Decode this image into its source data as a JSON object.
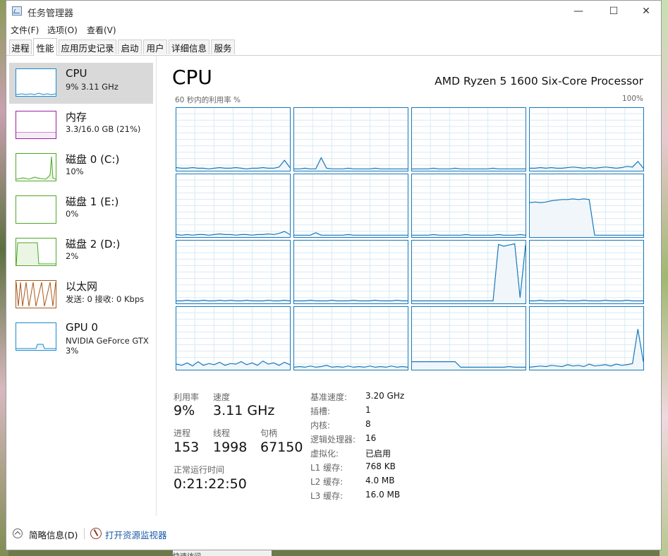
{
  "window": {
    "title": "任务管理器",
    "minimize": "—",
    "maximize": "☐",
    "close": "✕"
  },
  "menu": [
    "文件(F)",
    "选项(O)",
    "查看(V)"
  ],
  "tabs": [
    "进程",
    "性能",
    "应用历史记录",
    "启动",
    "用户",
    "详细信息",
    "服务"
  ],
  "active_tab": "性能",
  "sidebar": [
    {
      "title": "CPU",
      "sub": "9% 3.11 GHz",
      "sub2": "",
      "color": "#1a8ad0"
    },
    {
      "title": "内存",
      "sub": "3.3/16.0 GB (21%)",
      "sub2": "",
      "color": "#9b1fa0"
    },
    {
      "title": "磁盘 0 (C:)",
      "sub": "10%",
      "sub2": "",
      "color": "#4ca825"
    },
    {
      "title": "磁盘 1 (E:)",
      "sub": "0%",
      "sub2": "",
      "color": "#4ca825"
    },
    {
      "title": "磁盘 2 (D:)",
      "sub": "2%",
      "sub2": "",
      "color": "#4ca825"
    },
    {
      "title": "以太网",
      "sub": "发送: 0 接收: 0 Kbps",
      "sub2": "",
      "color": "#a8581c"
    },
    {
      "title": "GPU 0",
      "sub": "NVIDIA GeForce GTX",
      "sub2": "3%",
      "color": "#1a8ad0"
    }
  ],
  "main": {
    "title": "CPU",
    "processor": "AMD Ryzen 5 1600 Six-Core Processor",
    "axis_label": "60 秒内的利用率 %",
    "axis_max": "100%"
  },
  "core_graphs": [
    [
      4,
      3,
      3,
      4,
      3,
      3,
      2,
      3,
      4,
      3,
      3,
      4,
      3,
      2,
      3,
      3,
      4,
      3,
      3,
      5,
      16,
      4
    ],
    [
      2,
      2,
      3,
      2,
      2,
      20,
      3,
      2,
      2,
      2,
      3,
      2,
      2,
      2,
      2,
      3,
      2,
      2,
      2,
      2,
      2,
      2
    ],
    [
      2,
      2,
      2,
      2,
      3,
      2,
      2,
      2,
      3,
      2,
      2,
      2,
      2,
      2,
      2,
      3,
      2,
      2,
      2,
      2,
      2,
      2
    ],
    [
      3,
      3,
      4,
      3,
      4,
      3,
      3,
      4,
      5,
      4,
      3,
      4,
      3,
      4,
      5,
      4,
      3,
      4,
      6,
      5,
      14,
      3
    ],
    [
      3,
      2,
      3,
      2,
      3,
      3,
      2,
      3,
      4,
      3,
      3,
      2,
      3,
      3,
      2,
      3,
      3,
      4,
      3,
      5,
      8,
      3
    ],
    [
      2,
      2,
      2,
      2,
      6,
      2,
      2,
      2,
      2,
      2,
      3,
      2,
      2,
      2,
      2,
      2,
      2,
      2,
      2,
      2,
      2,
      2
    ],
    [
      2,
      2,
      2,
      2,
      3,
      2,
      2,
      2,
      2,
      2,
      3,
      2,
      2,
      2,
      2,
      2,
      3,
      2,
      2,
      2,
      3,
      2
    ],
    [
      55,
      56,
      55,
      56,
      58,
      59,
      60,
      60,
      61,
      60,
      61,
      60,
      2,
      2,
      2,
      2,
      2,
      2,
      2,
      2,
      2,
      2
    ],
    [
      3,
      3,
      4,
      3,
      3,
      4,
      3,
      3,
      4,
      3,
      4,
      3,
      3,
      4,
      3,
      3,
      3,
      4,
      3,
      3,
      4,
      3
    ],
    [
      3,
      3,
      3,
      4,
      3,
      3,
      3,
      4,
      3,
      3,
      3,
      4,
      3,
      3,
      3,
      4,
      3,
      3,
      3,
      4,
      3,
      3
    ],
    [
      3,
      3,
      3,
      3,
      3,
      3,
      3,
      3,
      3,
      3,
      3,
      3,
      3,
      3,
      3,
      3,
      95,
      92,
      94,
      96,
      8,
      94
    ],
    [
      3,
      3,
      4,
      3,
      3,
      3,
      4,
      3,
      3,
      3,
      4,
      3,
      3,
      3,
      4,
      3,
      3,
      3,
      4,
      3,
      3,
      3
    ],
    [
      8,
      6,
      10,
      5,
      12,
      6,
      9,
      7,
      11,
      6,
      9,
      8,
      12,
      7,
      10,
      6,
      13,
      8,
      10,
      6,
      11,
      7
    ],
    [
      3,
      4,
      3,
      5,
      3,
      4,
      6,
      3,
      4,
      3,
      5,
      3,
      4,
      3,
      5,
      3,
      4,
      3,
      5,
      3,
      4,
      3
    ],
    [
      12,
      12,
      12,
      12,
      12,
      12,
      12,
      12,
      12,
      3,
      3,
      3,
      3,
      3,
      3,
      3,
      3,
      3,
      4,
      3,
      3,
      3
    ],
    [
      3,
      4,
      5,
      4,
      6,
      5,
      4,
      7,
      5,
      6,
      4,
      8,
      5,
      6,
      7,
      5,
      8,
      6,
      7,
      9,
      65,
      12
    ]
  ],
  "stats": {
    "util_label": "利用率",
    "util_value": "9%",
    "speed_label": "速度",
    "speed_value": "3.11 GHz",
    "proc_label": "进程",
    "proc_value": "153",
    "thread_label": "线程",
    "thread_value": "1998",
    "handle_label": "句柄",
    "handle_value": "67150",
    "uptime_label": "正常运行时间",
    "uptime_value": "0:21:22:50"
  },
  "details": [
    {
      "label": "基准速度:",
      "value": "3.20 GHz"
    },
    {
      "label": "插槽:",
      "value": "1"
    },
    {
      "label": "内核:",
      "value": "8"
    },
    {
      "label": "逻辑处理器:",
      "value": "16"
    },
    {
      "label": "虚拟化:",
      "value": "已启用"
    },
    {
      "label": "L1 缓存:",
      "value": "768 KB"
    },
    {
      "label": "L2 缓存:",
      "value": "4.0 MB"
    },
    {
      "label": "L3 缓存:",
      "value": "16.0 MB"
    }
  ],
  "footer": {
    "less_details": "简略信息(D)",
    "open_monitor": "打开资源监视器"
  },
  "taskbar_peek": "快速访问",
  "colors": {
    "cpu_line": "#1779ba",
    "cpu_fill": "#f1f6fa",
    "grid": "#d9eaf4",
    "border": "#1779ba"
  }
}
